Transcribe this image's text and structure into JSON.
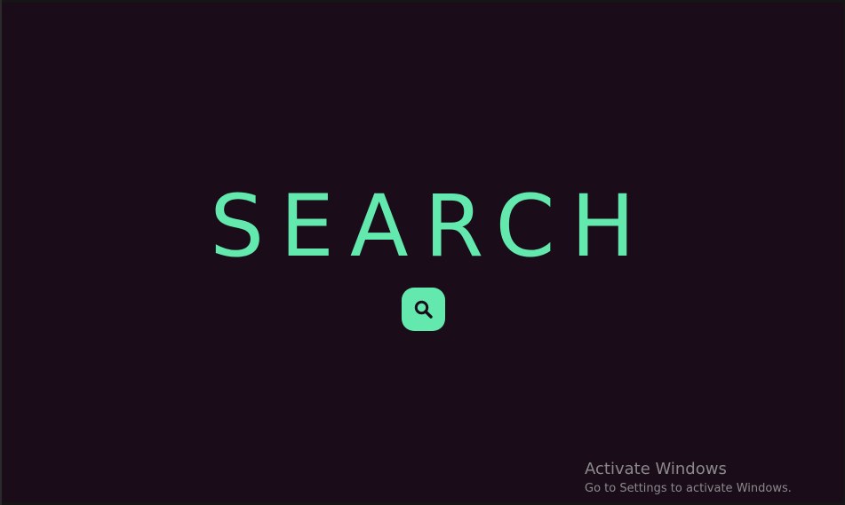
{
  "main": {
    "heading": "SEARCH",
    "search_button": {
      "icon": "search-icon"
    }
  },
  "watermark": {
    "title": "Activate Windows",
    "subtitle": "Go to Settings to activate Windows."
  },
  "colors": {
    "background": "#1b0c1a",
    "accent": "#63e8ae",
    "watermark_text": "#8a8a8a"
  }
}
